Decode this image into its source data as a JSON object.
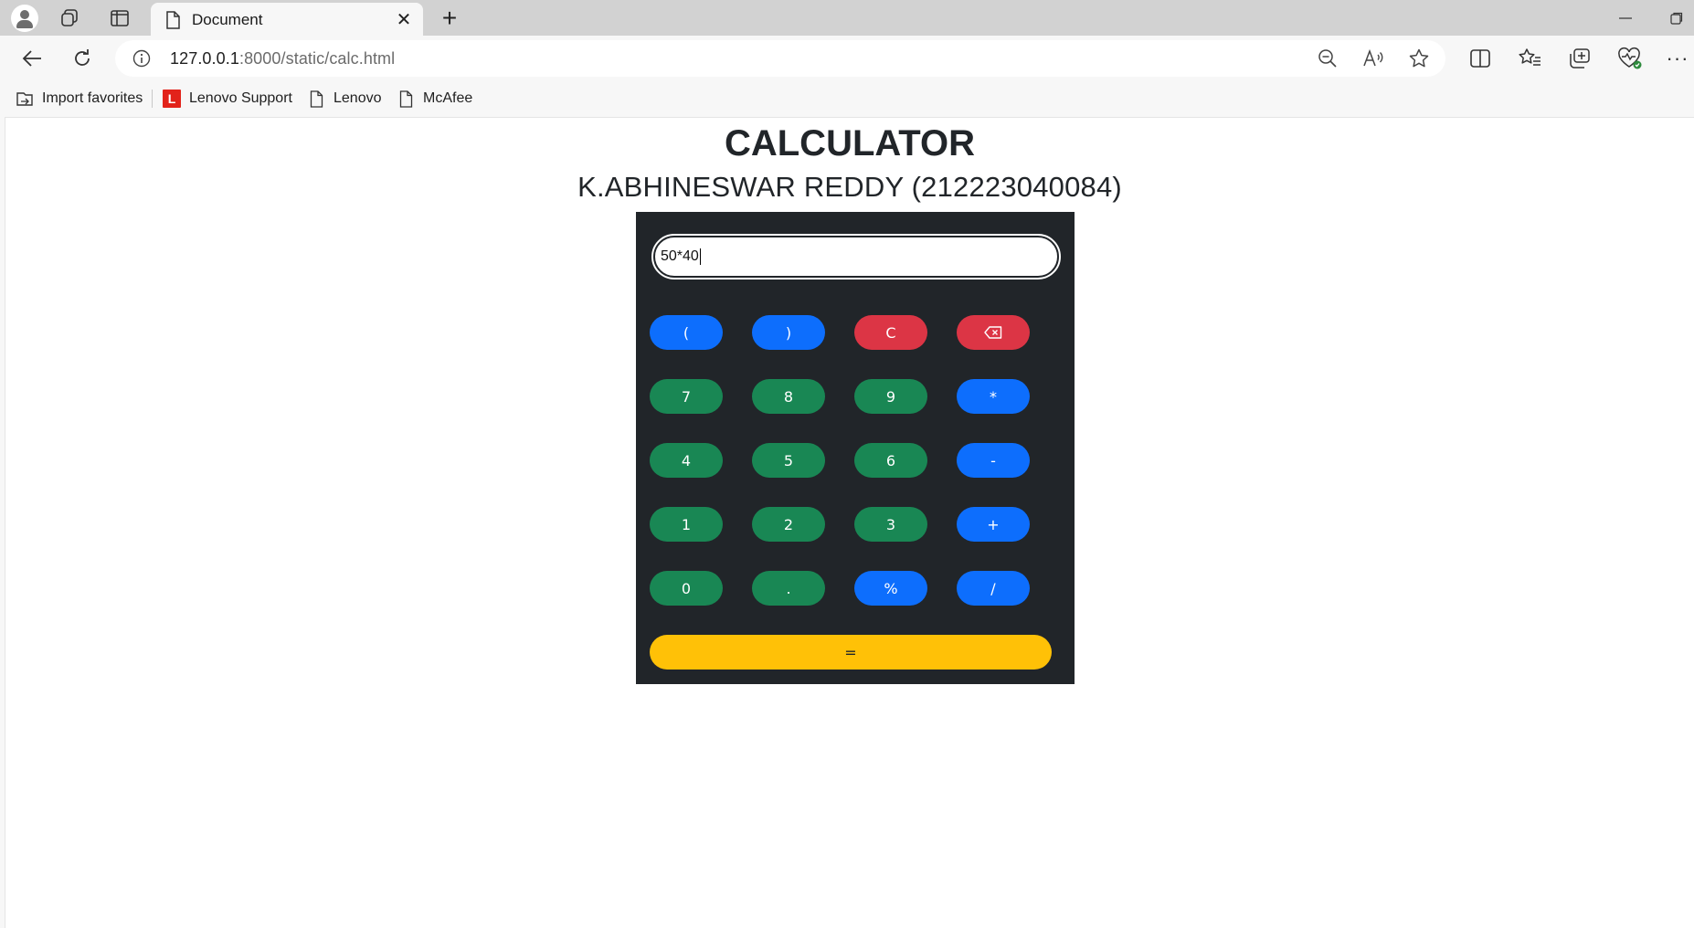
{
  "browser": {
    "tab_title": "Document",
    "url_host": "127.0.0.1",
    "url_rest": ":8000/static/calc.html",
    "bookmarks": [
      {
        "label": "Import favorites",
        "icon": "import-icon"
      },
      {
        "label": "Lenovo Support",
        "icon": "lenovo-logo-icon"
      },
      {
        "label": "Lenovo",
        "icon": "page-icon"
      },
      {
        "label": "McAfee",
        "icon": "page-icon"
      }
    ]
  },
  "page": {
    "title": "CALCULATOR",
    "subtitle": "K.ABHINESWAR REDDY (212223040084)"
  },
  "calculator": {
    "display_value": "50*40",
    "buttons": {
      "open_paren": "(",
      "close_paren": ")",
      "clear": "C",
      "seven": "7",
      "eight": "8",
      "nine": "9",
      "multiply": "*",
      "four": "4",
      "five": "5",
      "six": "6",
      "subtract": "-",
      "one": "1",
      "two": "2",
      "three": "3",
      "add": "+",
      "zero": "0",
      "decimal": ".",
      "percent": "%",
      "divide": "/",
      "equals": "="
    },
    "colors": {
      "panel": "#212529",
      "operator": "#0d6efd",
      "digit": "#198754",
      "clear": "#dc3545",
      "equals": "#ffc107"
    }
  }
}
